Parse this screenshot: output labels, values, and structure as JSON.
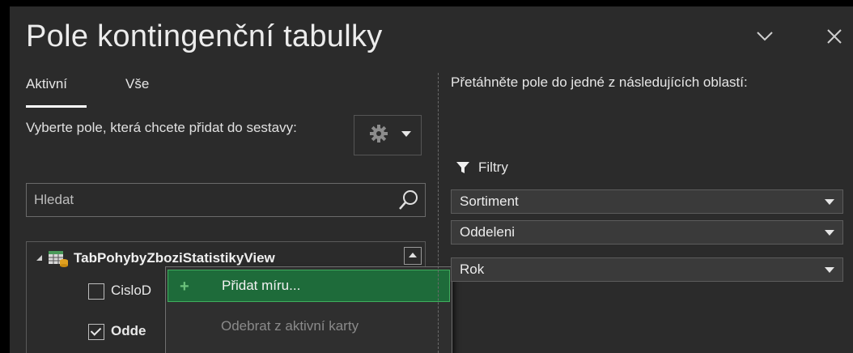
{
  "window": {
    "title": "Pole kontingenční tabulky",
    "collapse_icon": "chevron-down-icon",
    "close_icon": "close-icon"
  },
  "tabs": [
    {
      "label": "Aktivní",
      "active": true
    },
    {
      "label": "Vše",
      "active": false
    }
  ],
  "left": {
    "instruction": "Vyberte pole, která chcete přidat do sestavy:",
    "settings_icon": "gear-icon",
    "search_placeholder": "Hledat",
    "table": {
      "name": "TabPohybyZboziStatistikyView",
      "fields": [
        {
          "label": "CisloD",
          "checked": false
        },
        {
          "label": "Odde",
          "checked": true
        }
      ]
    }
  },
  "context_menu": {
    "items": [
      {
        "label": "Přidat míru...",
        "enabled": true,
        "icon": "plus-icon"
      },
      {
        "label": "Odebrat z aktivní karty",
        "enabled": false
      }
    ]
  },
  "right": {
    "drag_instruction": "Přetáhněte pole do jedné z následujících oblastí:",
    "filters_label": "Filtry",
    "filters": [
      {
        "label": "Sortiment"
      },
      {
        "label": "Oddeleni"
      },
      {
        "label": "Rok"
      }
    ]
  },
  "colors": {
    "background": "#2b2b2b",
    "menu_highlight": "#1e6b3a",
    "menu_highlight_border": "#3fae5e",
    "accent_green": "#6cc27c"
  }
}
